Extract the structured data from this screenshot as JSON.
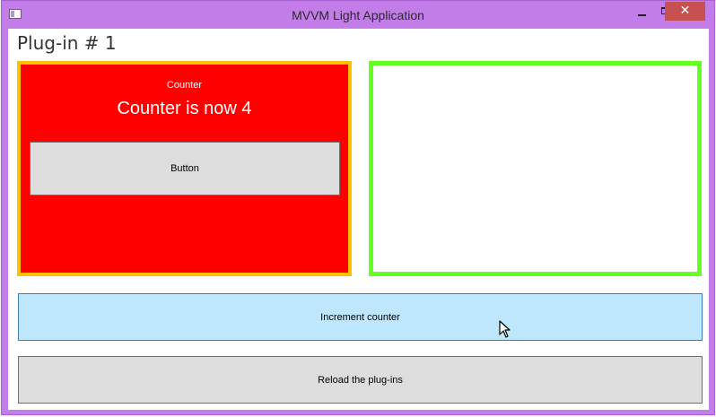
{
  "window": {
    "title": "MVVM Light Application",
    "close_glyph": "✕",
    "accent_color": "#c27de8"
  },
  "plugin": {
    "title": "Plug-in # 1"
  },
  "red_panel": {
    "label": "Counter",
    "value_text": "Counter is now 4",
    "button_label": "Button",
    "background": "#ff0000",
    "border": "#ffc000"
  },
  "green_panel": {
    "border": "#66ff22"
  },
  "actions": {
    "increment_label": "Increment counter",
    "reload_label": "Reload the plug-ins"
  },
  "icons": [
    "app-icon",
    "minimize-icon",
    "maximize-icon",
    "close-icon",
    "mouse-cursor-icon"
  ]
}
